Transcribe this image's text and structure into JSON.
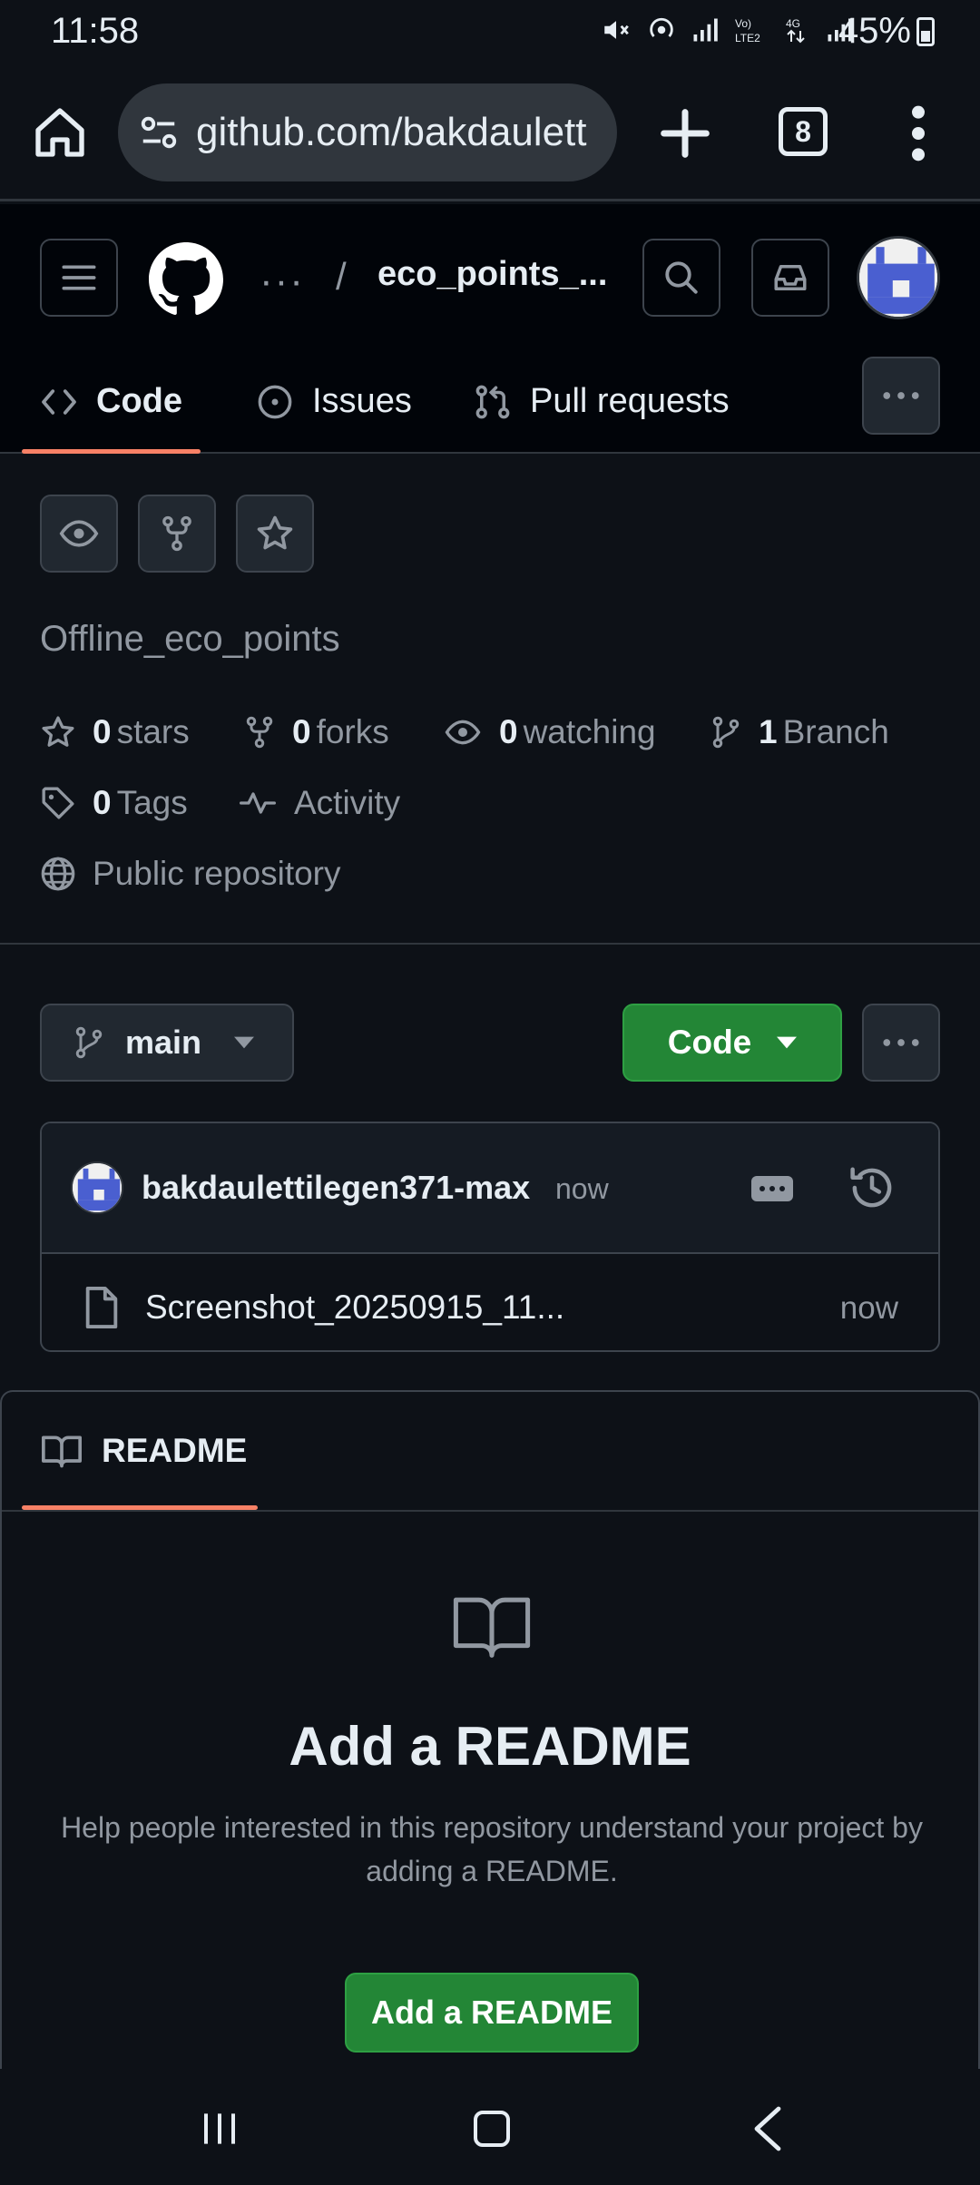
{
  "status_bar": {
    "time": "11:58",
    "battery": "45%"
  },
  "browser": {
    "url": "github.com/bakdaulett",
    "tab_count": "8"
  },
  "header": {
    "breadcrumb_dots": "···",
    "breadcrumb_slash": "/",
    "repo_name": "eco_points_..."
  },
  "nav_tabs": [
    {
      "label": "Code",
      "active": true
    },
    {
      "label": "Issues",
      "active": false
    },
    {
      "label": "Pull requests",
      "active": false
    }
  ],
  "repo": {
    "description": "Offline_eco_points",
    "stars_count": "0",
    "stars_label": "stars",
    "forks_count": "0",
    "forks_label": "forks",
    "watching_count": "0",
    "watching_label": "watching",
    "branch_count": "1",
    "branch_label": "Branch",
    "tags_count": "0",
    "tags_label": "Tags",
    "activity_label": "Activity",
    "visibility_label": "Public repository"
  },
  "branch_bar": {
    "branch": "main",
    "code_button": "Code"
  },
  "commit": {
    "author": "bakdaulettilegen371-max",
    "time": "now",
    "file_name": "Screenshot_20250915_11...",
    "file_time": "now"
  },
  "readme": {
    "tab_label": "README",
    "title": "Add a README",
    "description": "Help people interested in this repository understand your project by adding a README.",
    "button_label": "Add a README"
  },
  "colors": {
    "background": "#0d1117",
    "header_bg": "#010409",
    "accent_green": "#238636",
    "tab_underline": "#f78166",
    "muted_text": "#9198a1",
    "avatar_blue": "#4a5fd0"
  }
}
